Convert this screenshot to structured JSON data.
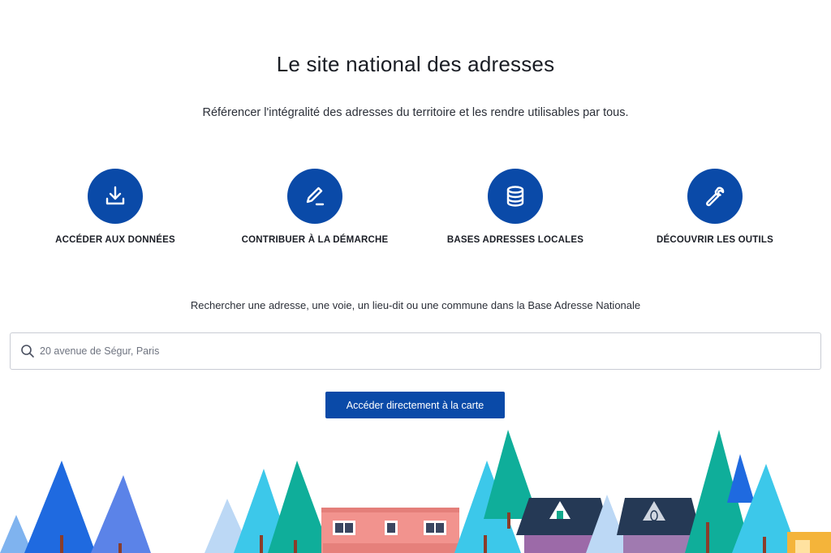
{
  "header": {
    "title": "Le site national des adresses",
    "subtitle": "Référencer l'intégralité des adresses du territoire et les rendre utilisables par tous."
  },
  "features": [
    {
      "label": "ACCÉDER AUX DONNÉES",
      "icon": "download-icon"
    },
    {
      "label": "CONTRIBUER À LA DÉMARCHE",
      "icon": "pencil-icon"
    },
    {
      "label": "BASES ADRESSES LOCALES",
      "icon": "database-icon"
    },
    {
      "label": "DÉCOUVRIR LES OUTILS",
      "icon": "wrench-icon"
    }
  ],
  "search": {
    "caption": "Rechercher une adresse, une voie, un lieu-dit ou une commune dans la Base Adresse Nationale",
    "placeholder": "20 avenue de Ségur, Paris"
  },
  "cta": {
    "label": "Accéder directement à la carte"
  },
  "colors": {
    "primary": "#0a4aa8",
    "text": "#1a1d24",
    "border": "#c9ccd4"
  }
}
